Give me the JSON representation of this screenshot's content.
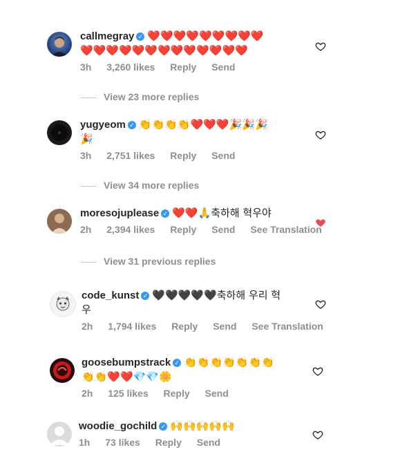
{
  "comments": [
    {
      "username": "callmegray",
      "text_line1": "❤️❤️❤️❤️❤️❤️❤️❤️❤️",
      "text_line2": "❤️❤️❤️❤️❤️❤️❤️❤️❤️❤️❤️❤️❤️",
      "time": "3h",
      "likes": "3,260 likes",
      "reply": "Reply",
      "send": "Send",
      "liked": false
    },
    {
      "username": "yugyeom",
      "text_line1": "👏👏👏👏❤️❤️❤️🎉🎉🎉",
      "text_line2": "🎉",
      "time": "3h",
      "likes": "2,751 likes",
      "reply": "Reply",
      "send": "Send",
      "liked": false
    },
    {
      "username": "moresojuplease",
      "text_line1": "❤️❤️🙏축하해 혁우야",
      "time": "2h",
      "likes": "2,394 likes",
      "reply": "Reply",
      "send": "Send",
      "translation": "See Translation",
      "liked": true
    },
    {
      "username": "code_kunst",
      "text_line1": "🖤🖤🖤🖤🖤축하해 우리 혁",
      "text_line2": "우",
      "time": "2h",
      "likes": "1,794 likes",
      "reply": "Reply",
      "send": "Send",
      "translation": "See Translation",
      "liked": false
    },
    {
      "username": "goosebumpstrack",
      "text_line1": "👏👏👏👏👏👏👏",
      "text_line2": "👏👏❤️❤️💎💎🌼",
      "time": "2h",
      "likes": "125 likes",
      "reply": "Reply",
      "send": "Send",
      "liked": false
    },
    {
      "username": "woodie_gochild",
      "text_line1": "🙌🙌🙌🙌🙌",
      "time": "1h",
      "likes": "73 likes",
      "reply": "Reply",
      "send": "Send",
      "liked": false
    }
  ],
  "view_replies": [
    "View 23 more replies",
    "View 34 more replies",
    "View 31 previous replies"
  ],
  "colors": {
    "verified": "#3897f0",
    "meta": "#8e8e8e",
    "liked_heart": "#ed4956"
  }
}
